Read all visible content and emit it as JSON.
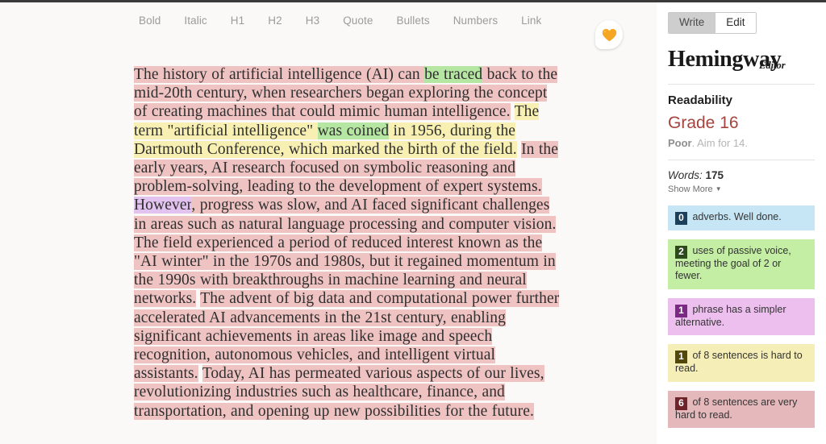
{
  "toolbar": {
    "items": [
      {
        "label": "Bold",
        "name": "bold"
      },
      {
        "label": "Italic",
        "name": "italic"
      },
      {
        "label": "H1",
        "name": "h1"
      },
      {
        "label": "H2",
        "name": "h2"
      },
      {
        "label": "H3",
        "name": "h3"
      },
      {
        "label": "Quote",
        "name": "quote"
      },
      {
        "label": "Bullets",
        "name": "bullets"
      },
      {
        "label": "Numbers",
        "name": "numbers"
      },
      {
        "label": "Link",
        "name": "link"
      }
    ],
    "bubble_icon": "heart-icon",
    "bubble_icon_color": "#f5a623"
  },
  "document": {
    "segments": [
      {
        "text": "The history of artificial intelligence (AI) can ",
        "highlight": "vhard"
      },
      {
        "text": "be traced",
        "highlight": "passive"
      },
      {
        "text": " back to the mid-20th century, when researchers began exploring the concept of creating machines that could mimic human intelligence.",
        "highlight": "vhard"
      },
      {
        "text": " ",
        "highlight": "none"
      },
      {
        "text": "The term \"artificial intelligence\" ",
        "highlight": "hard"
      },
      {
        "text": "was coined",
        "highlight": "passive"
      },
      {
        "text": " in 1956, during the Dartmouth Conference, which marked the birth of the field.",
        "highlight": "hard"
      },
      {
        "text": " ",
        "highlight": "none"
      },
      {
        "text": "In the early years, AI research focused on symbolic reasoning and problem-solving, leading to the development of expert systems.",
        "highlight": "vhard"
      },
      {
        "text": " ",
        "highlight": "none"
      },
      {
        "text": "However",
        "highlight": "simpler"
      },
      {
        "text": ", progress was slow, and AI faced significant challenges in areas such as natural language processing and computer vision.",
        "highlight": "vhard"
      },
      {
        "text": " ",
        "highlight": "none"
      },
      {
        "text": "The field experienced a period of reduced interest known as the \"AI winter\" in the 1970s and 1980s, but it regained momentum in the 1990s with breakthroughs in machine learning and neural networks.",
        "highlight": "vhard"
      },
      {
        "text": " ",
        "highlight": "none"
      },
      {
        "text": "The advent of big data and computational power further accelerated AI advancements in the 21st century, enabling significant achievements in areas like image and speech recognition, autonomous vehicles, and intelligent virtual assistants.",
        "highlight": "vhard"
      },
      {
        "text": " ",
        "highlight": "none"
      },
      {
        "text": "Today, AI has permeated various aspects of our lives, revolutionizing industries such as healthcare, finance, and transportation, and opening up new possibilities for the future.",
        "highlight": "vhard"
      }
    ]
  },
  "sidebar": {
    "mode_toggle": {
      "write_label": "Write",
      "edit_label": "Edit",
      "active": "Edit"
    },
    "brand": {
      "name": "Hemingway",
      "sub": "Editor"
    },
    "readability": {
      "title": "Readability",
      "grade": "Grade 16",
      "grade_color": "#a4443f",
      "quality": "Poor",
      "aim": ". Aim for 14."
    },
    "stats": {
      "words_label": "Words:",
      "words_count": "175",
      "show_more": "Show More",
      "caret_icon": "chevron-down-icon"
    },
    "cards": [
      {
        "count": "0",
        "text": " adverbs. Well done.",
        "name": "adverbs-card",
        "color": "#c6e6f6"
      },
      {
        "count": "2",
        "text": " uses of passive voice, meeting the goal of 2 or fewer.",
        "name": "passive-voice-card",
        "color": "#c3eea4"
      },
      {
        "count": "1",
        "text": " phrase has a simpler alternative.",
        "name": "simpler-alternative-card",
        "color": "#edbfef"
      },
      {
        "count": "1",
        "text": " of 8 sentences is hard to read.",
        "name": "hard-to-read-card",
        "color": "#f5eeb6"
      },
      {
        "count": "6",
        "text": " of 8 sentences are very hard to read.",
        "name": "very-hard-to-read-card",
        "color": "#e5b8bb"
      }
    ]
  }
}
